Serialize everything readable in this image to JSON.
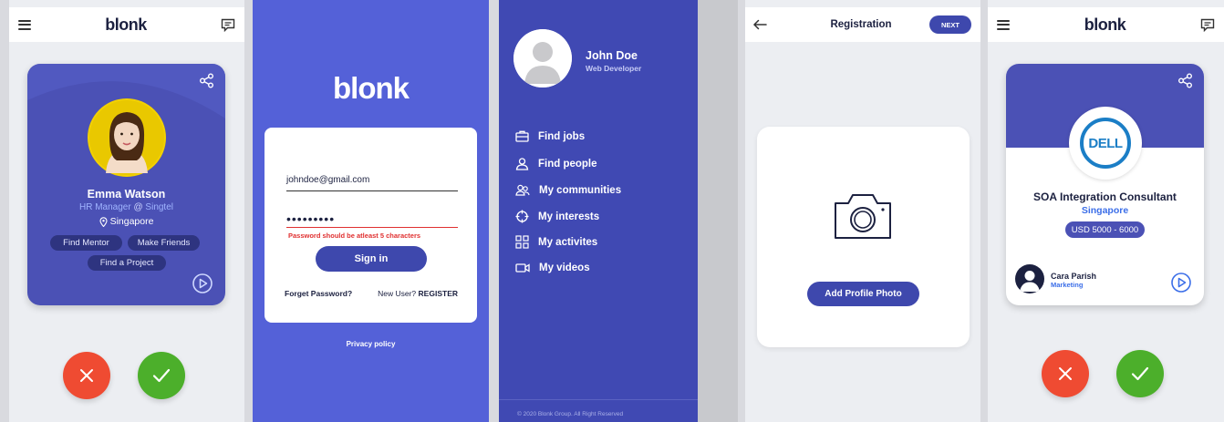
{
  "app": {
    "logo_text": "blonk"
  },
  "screen1": {
    "name": "Emma Watson",
    "role": "HR Manager",
    "at": "@",
    "company": "Singtel",
    "location": "Singapore",
    "chips": [
      "Find Mentor",
      "Make Friends",
      "Find a Project"
    ]
  },
  "screen2": {
    "logo": "blonk",
    "email_value": "johndoe@gmail.com",
    "password_value": "•••••••••",
    "error": "Password should be atleast 5 characters",
    "signin_label": "Sign in",
    "forgot_label": "Forget Password?",
    "new_user_label": "New User?",
    "register_label": "REGISTER",
    "privacy_label": "Privacy policy"
  },
  "screen3": {
    "name": "John Doe",
    "title": "Web Developer",
    "menu": [
      {
        "label": "Find jobs",
        "icon": "briefcase-icon"
      },
      {
        "label": "Find people",
        "icon": "person-icon"
      },
      {
        "label": "My communities",
        "icon": "group-icon"
      },
      {
        "label": "My interests",
        "icon": "target-icon"
      },
      {
        "label": "My activites",
        "icon": "grid-icon"
      },
      {
        "label": "My videos",
        "icon": "video-icon"
      }
    ],
    "footer": "© 2020 Blonk Group. All Right Reserved"
  },
  "screen4": {
    "title": "Registration",
    "next_label": "NEXT",
    "add_photo_label": "Add Profile Photo"
  },
  "screen5": {
    "company_logo_text": "DELL",
    "job_title": "SOA Integration Consultant",
    "location": "Singapore",
    "salary": "USD 5000 - 6000",
    "contact_name": "Cara Parish",
    "contact_dept": "Marketing"
  },
  "colors": {
    "brand_purple": "#4b51b5",
    "login_bg": "#5461d8",
    "drawer_bg": "#4049b3",
    "reject_red": "#ef4b32",
    "accept_green": "#4caf2b",
    "link_blue": "#3b6ee8",
    "error_red": "#e03030"
  }
}
